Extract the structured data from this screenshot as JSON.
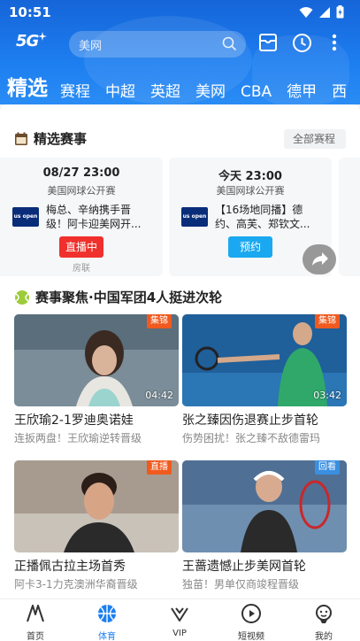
{
  "status_bar": {
    "time": "10:51"
  },
  "header": {
    "logo": "5G",
    "search_placeholder": "美网",
    "tabs": [
      "精选",
      "赛程",
      "中超",
      "英超",
      "美网",
      "CBA",
      "德甲",
      "西"
    ]
  },
  "featured_matches": {
    "title": "精选赛事",
    "all_label": "全部赛程",
    "cards": [
      {
        "time": "08/27 23:00",
        "event": "美国网球公开赛",
        "logo_text": "us open",
        "description": "梅总、辛纳携手晋级！阿卡迎美网开...",
        "button": "直播中",
        "sub": "房联"
      },
      {
        "time": "今天 23:00",
        "event": "美国网球公开赛",
        "logo_text": "us open",
        "description": "【16场地同播】德约、高芙、郑钦文...",
        "button": "预约"
      }
    ]
  },
  "focus": {
    "title": "赛事聚焦·中国军团4人挺进次轮",
    "items": [
      {
        "title": "王欣瑜2-1罗迪奥诺娃",
        "subtitle": "连扳两盘！王欣瑜逆转晋级",
        "tag": "集锦",
        "duration": "04:42"
      },
      {
        "title": "张之臻因伤退赛止步首轮",
        "subtitle": "伤势困扰！张之臻不敌德雷玛",
        "tag": "集锦",
        "duration": "03:42"
      },
      {
        "title": "正播佩古拉主场首秀",
        "subtitle": "阿卡3-1力克澳洲华裔晋级",
        "tag": "直播"
      },
      {
        "title": "王蔷遗憾止步美网首轮",
        "subtitle": "独苗！男单仅商竣程晋级",
        "tag": "回看"
      }
    ]
  },
  "bottom_nav": [
    {
      "label": "首页",
      "icon": "home-icon"
    },
    {
      "label": "体育",
      "icon": "basketball-icon",
      "active": true
    },
    {
      "label": "VIP",
      "icon": "vip-icon"
    },
    {
      "label": "短视频",
      "icon": "play-icon"
    },
    {
      "label": "我的",
      "icon": "profile-icon"
    }
  ],
  "colors": {
    "header_blue": "#1d7ef0",
    "live_red": "#f0302c",
    "reserve_blue": "#1aa9f0",
    "active_tab": "#1a7ff0"
  }
}
